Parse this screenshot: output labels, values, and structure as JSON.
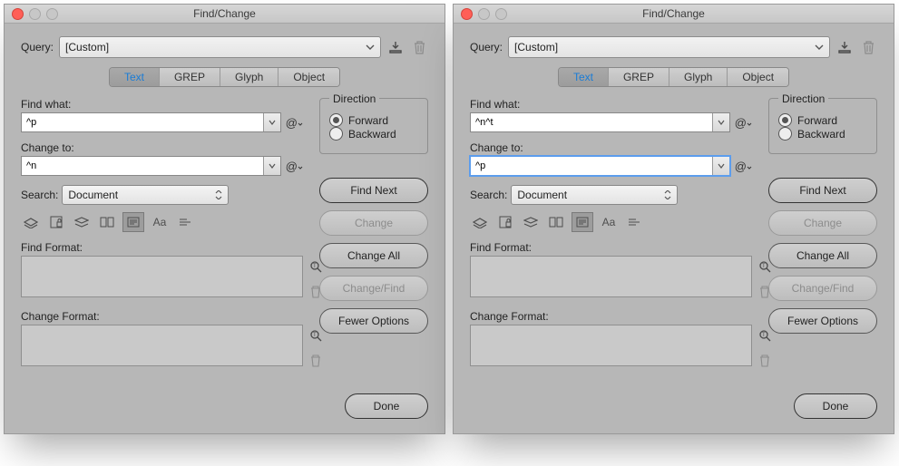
{
  "windows": [
    {
      "title": "Find/Change",
      "query": {
        "label": "Query:",
        "value": "[Custom]"
      },
      "tabs": [
        "Text",
        "GREP",
        "Glyph",
        "Object"
      ],
      "active_tab": "Text",
      "find": {
        "label": "Find what:",
        "value": "^p"
      },
      "change": {
        "label": "Change to:",
        "value": "^n",
        "focused": false
      },
      "search": {
        "label": "Search:",
        "value": "Document"
      },
      "find_format_label": "Find Format:",
      "change_format_label": "Change Format:",
      "direction": {
        "title": "Direction",
        "forward": "Forward",
        "backward": "Backward",
        "selected": "forward"
      },
      "buttons": {
        "find_next": "Find Next",
        "change": "Change",
        "change_all": "Change All",
        "change_find": "Change/Find",
        "fewer": "Fewer Options",
        "done": "Done"
      }
    },
    {
      "title": "Find/Change",
      "query": {
        "label": "Query:",
        "value": "[Custom]"
      },
      "tabs": [
        "Text",
        "GREP",
        "Glyph",
        "Object"
      ],
      "active_tab": "Text",
      "find": {
        "label": "Find what:",
        "value": "^n^t"
      },
      "change": {
        "label": "Change to:",
        "value": "^p",
        "focused": true
      },
      "search": {
        "label": "Search:",
        "value": "Document"
      },
      "find_format_label": "Find Format:",
      "change_format_label": "Change Format:",
      "direction": {
        "title": "Direction",
        "forward": "Forward",
        "backward": "Backward",
        "selected": "forward"
      },
      "buttons": {
        "find_next": "Find Next",
        "change": "Change",
        "change_all": "Change All",
        "change_find": "Change/Find",
        "fewer": "Fewer Options",
        "done": "Done"
      }
    }
  ]
}
